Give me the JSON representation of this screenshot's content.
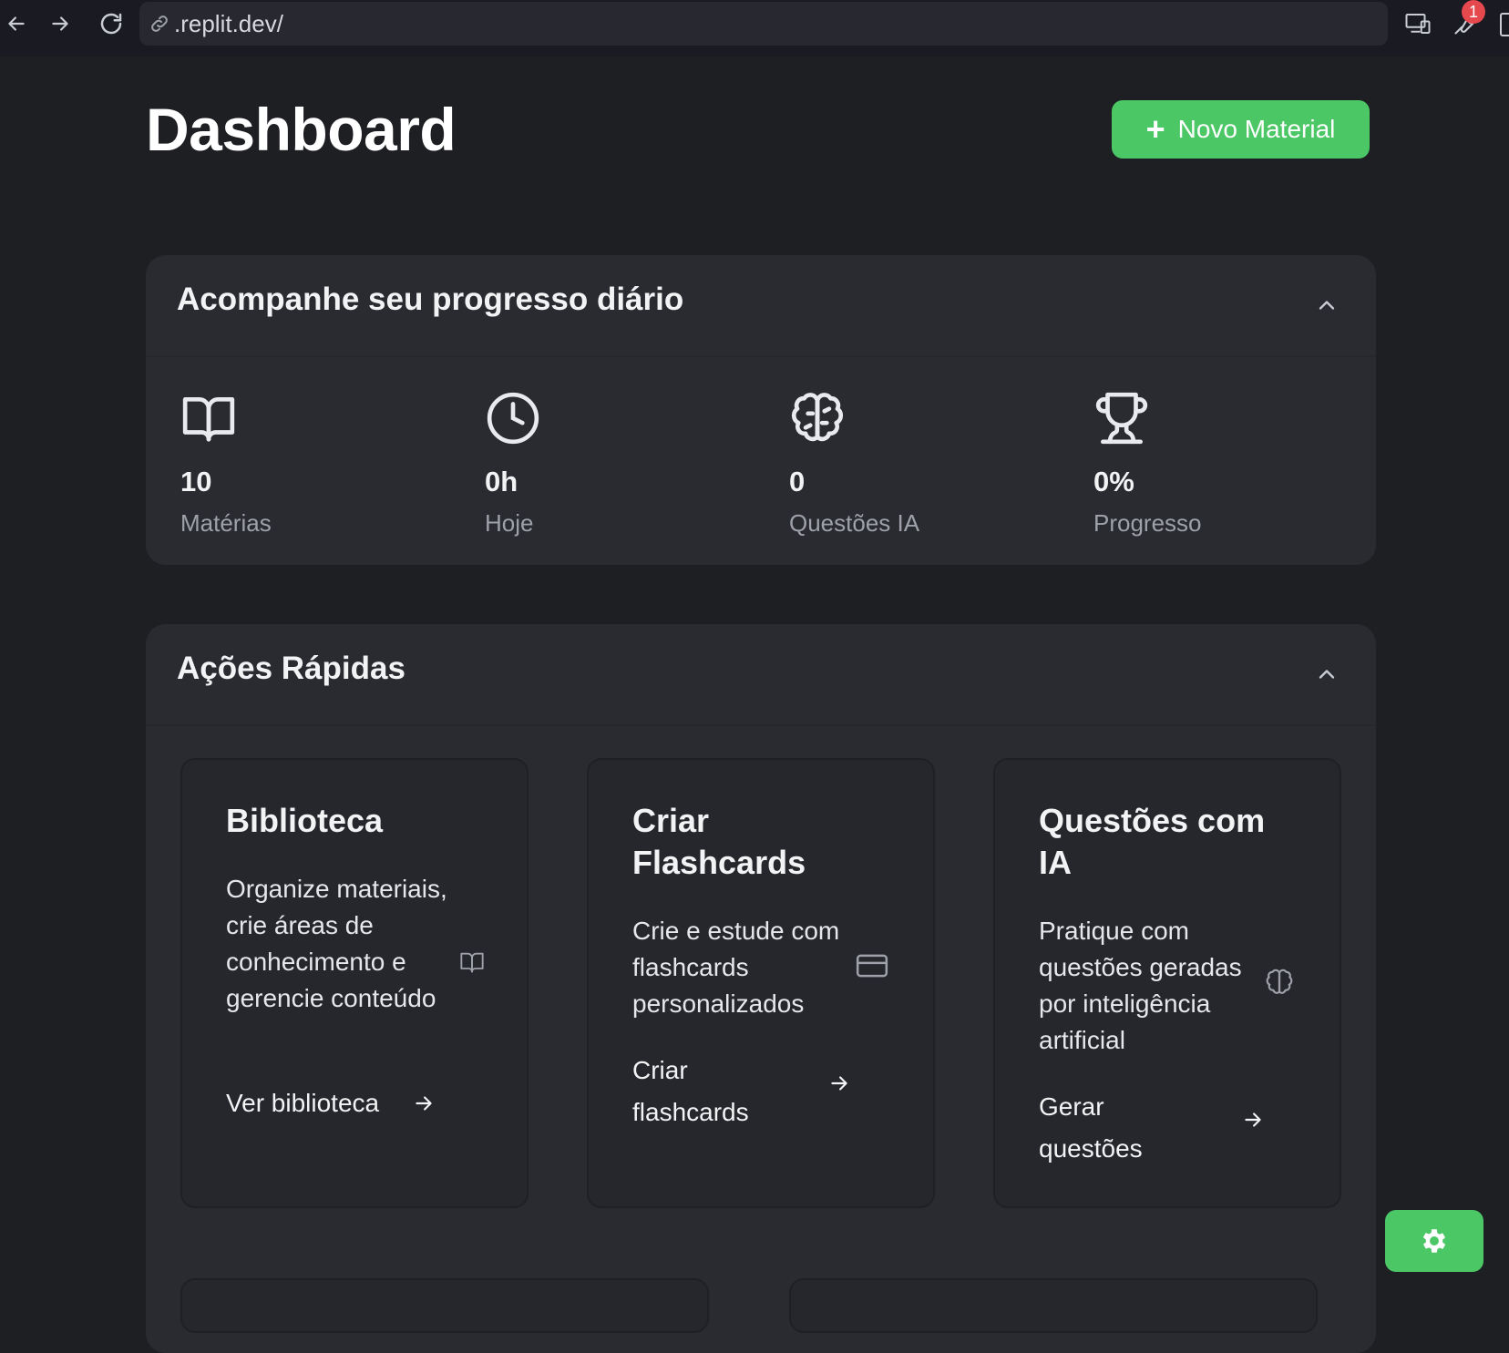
{
  "browser": {
    "url": ".replit.dev/",
    "notification_count": "1"
  },
  "header": {
    "title": "Dashboard",
    "new_material_label": "Novo Material"
  },
  "progress": {
    "title": "Acompanhe seu progresso diário",
    "stats": [
      {
        "icon": "book-open-icon",
        "value": "10",
        "label": "Matérias"
      },
      {
        "icon": "clock-icon",
        "value": "0h",
        "label": "Hoje"
      },
      {
        "icon": "brain-icon",
        "value": "0",
        "label": "Questões IA"
      },
      {
        "icon": "trophy-icon",
        "value": "0%",
        "label": "Progresso"
      }
    ]
  },
  "quick_actions": {
    "title": "Ações Rápidas",
    "cards": [
      {
        "icon": "book-open-icon",
        "title": "Biblioteca",
        "description": "Organize materiais, crie áreas de conhecimento e gerencie conteúdo",
        "link": "Ver biblioteca"
      },
      {
        "icon": "credit-card-icon",
        "title": "Criar Flashcards",
        "description": "Crie e estude com flashcards personalizados",
        "link": "Criar flashcards"
      },
      {
        "icon": "brain-icon",
        "title": "Questões com IA",
        "description": "Pratique com questões geradas por inteligência artificial",
        "link": "Gerar questões"
      }
    ]
  },
  "colors": {
    "background": "#1e1f23",
    "card": "#2a2b31",
    "accent_green": "#4cc766",
    "muted_text": "#9ea1a9"
  }
}
